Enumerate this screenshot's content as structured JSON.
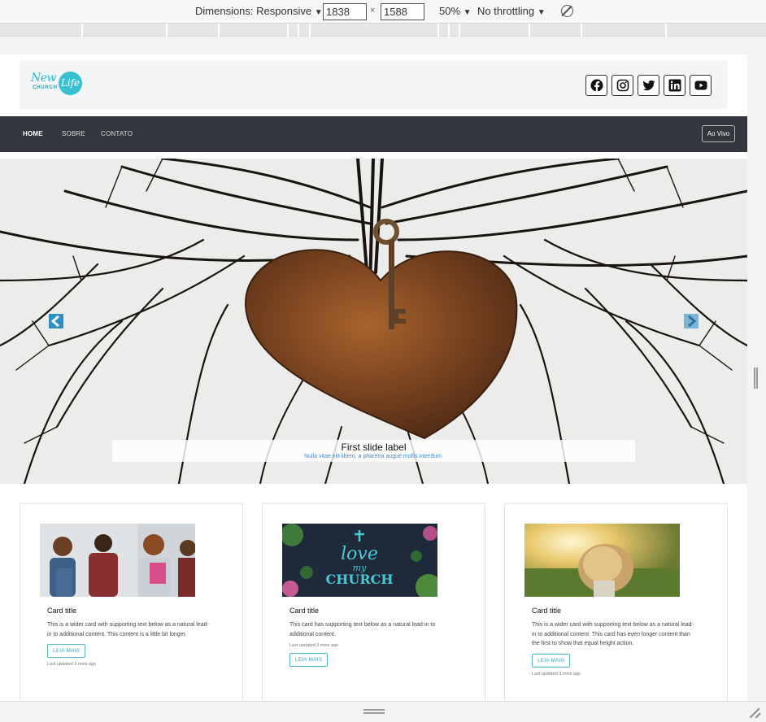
{
  "devtools": {
    "dimensions_label": "Dimensions: Responsive",
    "width_value": "1838",
    "times": "×",
    "height_value": "1588",
    "zoom": "50%",
    "throttling": "No throttling",
    "dropdown_glyph": "▼"
  },
  "site": {
    "logo": {
      "script": "New",
      "circle_text": "Life",
      "church": "CHURCH"
    },
    "socials": [
      "facebook-icon",
      "instagram-icon",
      "twitter-icon",
      "linkedin-icon",
      "youtube-icon"
    ],
    "nav": {
      "home": "HOME",
      "about": "SOBRE",
      "contact": "CONTATO",
      "live": "Ao Vivo"
    },
    "carousel": {
      "caption_title": "First slide label",
      "caption_text": "Nulla vitae elit libero, a pharetra augue mollis interdum.",
      "prev_icon": "chevron-left-icon",
      "next_icon": "chevron-right-icon"
    },
    "cards": [
      {
        "title": "Card title",
        "text": "This is a wider card with supporting text below as a natural lead-in to additional content. This content is a little bit longer.",
        "button": "LEIA MAIS",
        "updated": "Last updated 3 mins ago"
      },
      {
        "title": "Card title",
        "text": "This card has supporting text below as a natural lead-in to additional content.",
        "updated": "Last updated 3 mins ago",
        "button": "LEIA MAIS"
      },
      {
        "title": "Card title",
        "text": "This is a wider card with supporting text below as a natural lead-in to additional content. This card has even longer content than the first to show that equal height action.",
        "button": "LEIA MAIS",
        "updated": "Last updated 3 mins ago"
      }
    ],
    "card2_image_text": {
      "line1": "love",
      "line2": "my",
      "line3": "CHURCH"
    }
  },
  "colors": {
    "nav_bg": "#33363c",
    "accent": "#35c1d0",
    "button_border": "#52b7c4"
  }
}
